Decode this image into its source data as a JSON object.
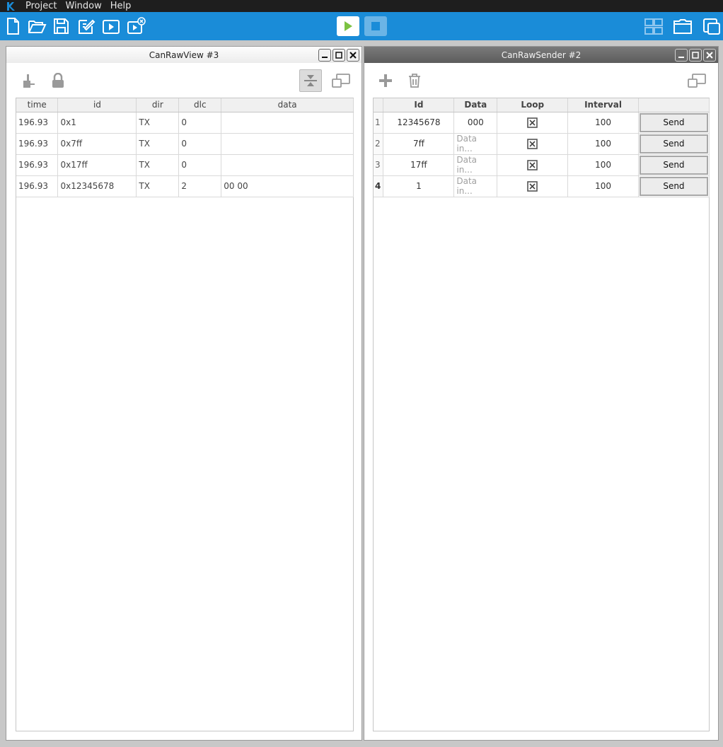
{
  "menubar": {
    "items": [
      "Project",
      "Window",
      "Help"
    ]
  },
  "toolbar": {
    "icons": [
      "new-file-icon",
      "open-folder-icon",
      "save-icon",
      "edit-icon",
      "play-window-icon",
      "close-video-icon",
      "grid-layout-icon",
      "folder-window-icon",
      "cascade-windows-icon"
    ],
    "accent": "#1a8cd8"
  },
  "view_window": {
    "title": "CanRawView #3",
    "columns": [
      "time",
      "id",
      "dir",
      "dlc",
      "data"
    ],
    "rows": [
      {
        "time": "196.93",
        "id": "0x1",
        "dir": "TX",
        "dlc": "0",
        "data": ""
      },
      {
        "time": "196.93",
        "id": "0x7ff",
        "dir": "TX",
        "dlc": "0",
        "data": ""
      },
      {
        "time": "196.93",
        "id": "0x17ff",
        "dir": "TX",
        "dlc": "0",
        "data": ""
      },
      {
        "time": "196.93",
        "id": "0x12345678",
        "dir": "TX",
        "dlc": "2",
        "data": "00 00"
      }
    ]
  },
  "sender_window": {
    "title": "CanRawSender #2",
    "columns": [
      "Id",
      "Data",
      "Loop",
      "Interval",
      ""
    ],
    "rows": [
      {
        "num": "1",
        "id": "12345678",
        "data": "000",
        "data_placeholder": false,
        "loop": true,
        "interval": "100",
        "send": "Send"
      },
      {
        "num": "2",
        "id": "7ff",
        "data": "Data in...",
        "data_placeholder": true,
        "loop": true,
        "interval": "100",
        "send": "Send"
      },
      {
        "num": "3",
        "id": "17ff",
        "data": "Data in...",
        "data_placeholder": true,
        "loop": true,
        "interval": "100",
        "send": "Send"
      },
      {
        "num": "4",
        "id": "1",
        "data": "Data in...",
        "data_placeholder": true,
        "loop": true,
        "interval": "100",
        "send": "Send"
      }
    ]
  }
}
